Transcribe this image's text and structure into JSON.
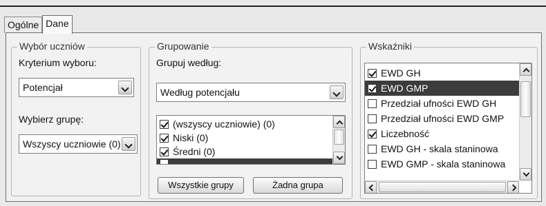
{
  "tabs": [
    {
      "label": "Ogólne"
    },
    {
      "label": "Dane"
    }
  ],
  "selection": {
    "legend": "Wybór uczniów",
    "criterion_label": "Kryterium wyboru:",
    "criterion_value": "Potencjał",
    "group_label": "Wybierz grupę:",
    "group_value": "Wszyscy uczniowie (0)"
  },
  "grouping": {
    "legend": "Grupowanie",
    "group_by_label": "Grupuj według:",
    "group_by_value": "Według potencjału",
    "items": [
      {
        "label": "(wszyscy uczniowie) (0)",
        "checked": true
      },
      {
        "label": "Niski (0)",
        "checked": true
      },
      {
        "label": "Średni (0)",
        "checked": true
      }
    ],
    "all_groups_button": "Wszystkie grupy",
    "no_group_button": "Żadna grupa"
  },
  "indicators": {
    "legend": "Wskaźniki",
    "items": [
      {
        "label": "EWD GH",
        "checked": true,
        "selected": false
      },
      {
        "label": "EWD GMP",
        "checked": true,
        "selected": true
      },
      {
        "label": "Przedział ufności EWD GH",
        "checked": false,
        "selected": false
      },
      {
        "label": "Przedział ufności EWD GMP",
        "checked": false,
        "selected": false
      },
      {
        "label": "Liczebność",
        "checked": true,
        "selected": false
      },
      {
        "label": "EWD GH - skala staninowa",
        "checked": false,
        "selected": false
      },
      {
        "label": "EWD GMP - skala staninowa",
        "checked": false,
        "selected": false
      }
    ]
  }
}
